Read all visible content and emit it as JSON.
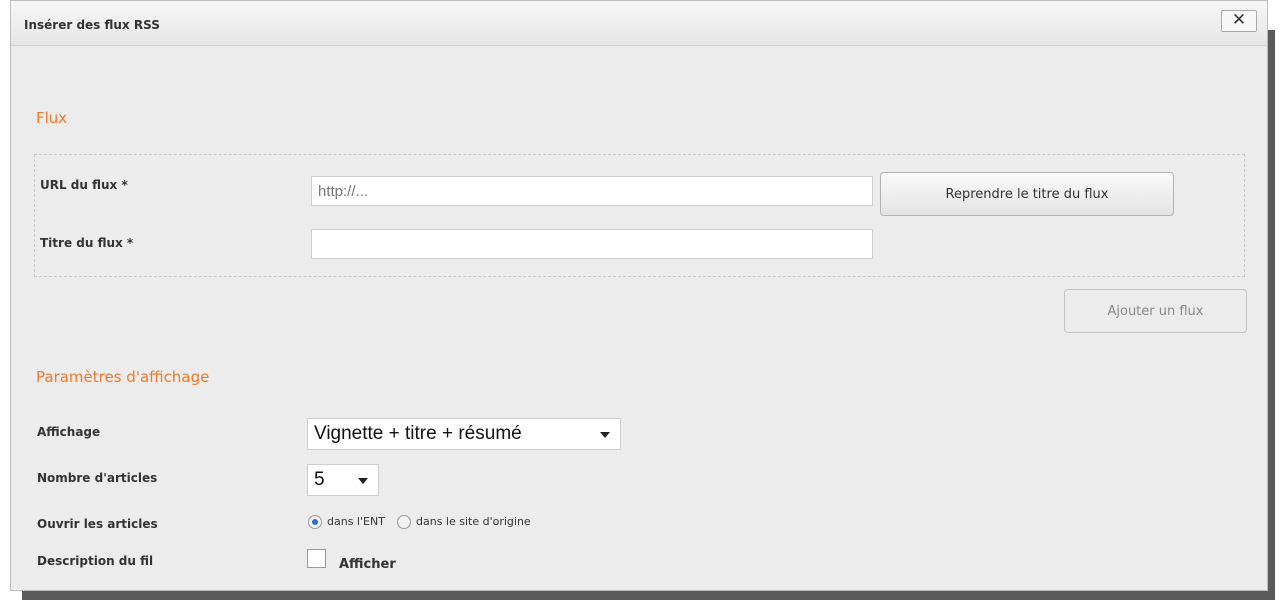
{
  "dialog": {
    "title": "Insérer des flux RSS",
    "close_label": "✕"
  },
  "feed_section": {
    "title": "Flux",
    "url_label": "URL du flux *",
    "url_placeholder": "http://...",
    "url_value": "",
    "fetch_title_button": "Reprendre le titre du flux",
    "title_label": "Titre du flux *",
    "title_value": "",
    "add_button": "Ajouter un flux"
  },
  "display_section": {
    "title": "Paramètres d'affichage",
    "display_label": "Affichage",
    "display_selected": "Vignette + titre + résumé",
    "count_label": "Nombre d'articles",
    "count_selected": "5",
    "open_label": "Ouvrir les articles",
    "open_options": [
      {
        "label": "dans l'ENT",
        "checked": true
      },
      {
        "label": "dans le site d'origine",
        "checked": false
      }
    ],
    "description_label": "Description du fil",
    "description_checkbox_label": "Afficher",
    "description_checked": false
  },
  "colors": {
    "accent": "#f07a2b",
    "radio_checked": "#2a6fd1"
  }
}
